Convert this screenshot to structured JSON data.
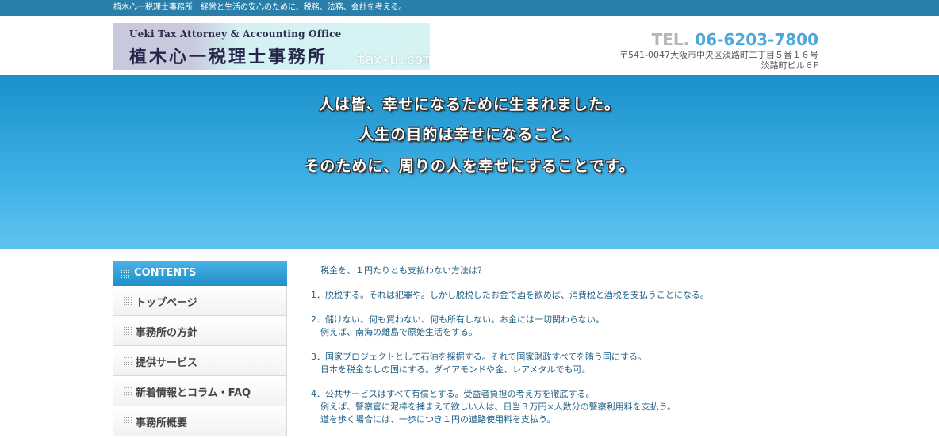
{
  "topbar": {
    "text": "植木心一税理士事務所　経営と生活の安心のために、税務、法務、会計を考える。"
  },
  "header": {
    "logo_en": "Ueki Tax Attorney & Accounting Office",
    "logo_jp": "植木心一税理士事務所",
    "logo_domain": "tax-u.com",
    "tel_label": "TEL.",
    "tel_number": "06-6203-7800",
    "address_line1": "〒541-0047大阪市中央区淡路町二丁目５番１６号",
    "address_line2": "淡路町ビル６F"
  },
  "hero": {
    "lines": [
      "人は皆、幸せになるために生まれました。",
      "人生の目的は幸せになること、",
      "そのために、周りの人を幸せにすることです。"
    ]
  },
  "sidebar": {
    "title": "CONTENTS",
    "items": [
      "トップページ",
      "事務所の方針",
      "提供サービス",
      "新着情報とコラム・FAQ",
      "事務所概要"
    ]
  },
  "main": {
    "question": "税金を、１円たりとも支払わない方法は？",
    "items": [
      {
        "lines": [
          "1．脱税する。それは犯罪や。しかし脱税したお金で酒を飲めば、消費税と酒税を支払うことになる。"
        ]
      },
      {
        "lines": [
          "2．儲けない、何も買わない、何も所有しない。お金には一切関わらない。",
          "例えば、南海の離島で原始生活をする。"
        ]
      },
      {
        "lines": [
          "3．国家プロジェクトとして石油を採掘する。それで国家財政すべてを賄う国にする。",
          "日本を税金なしの国にする。ダイアモンドや金、レアメタルでも可。"
        ]
      },
      {
        "lines": [
          "4．公共サービスはすべて有償とする。受益者負担の考え方を徹底する。",
          "例えば、警察官に泥棒を捕まえて欲しい人は、日当３万円×人数分の警察利用料を支払う。",
          "道を歩く場合には、一歩につき１円の道路使用料を支払う。"
        ]
      }
    ]
  },
  "colors": {
    "topbar": "#2a7faa",
    "hero": "#2aa2dc",
    "accent": "#4ca8dc",
    "body_text": "#1f5f86"
  }
}
